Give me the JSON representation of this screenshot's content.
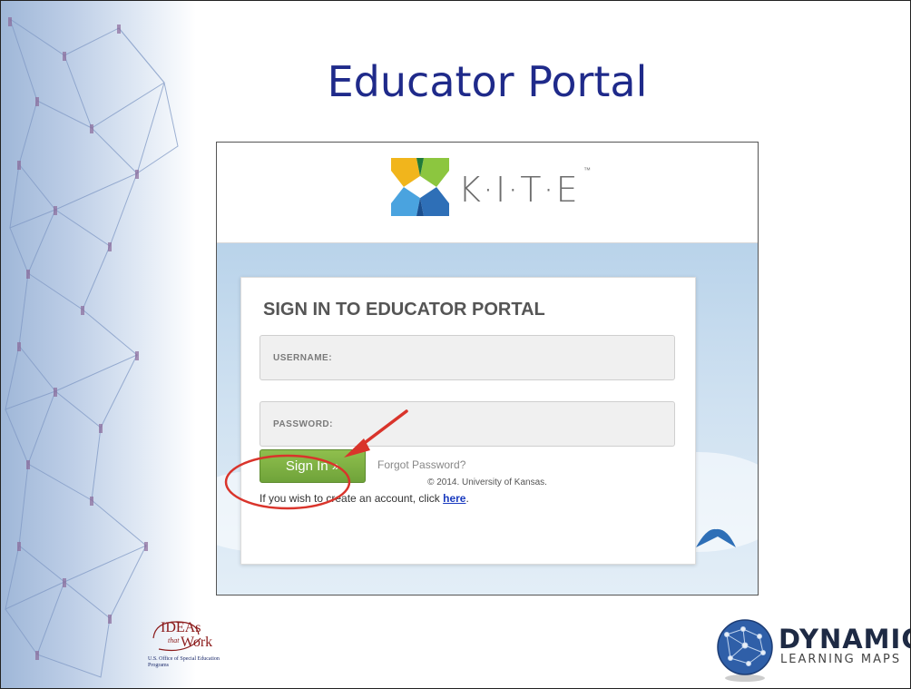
{
  "slide": {
    "title": "Educator Portal"
  },
  "kite": {
    "wordmark": "K·I·T·E",
    "trademark": "™"
  },
  "signin": {
    "heading": "SIGN IN TO EDUCATOR PORTAL",
    "username_placeholder": "USERNAME:",
    "password_placeholder": "PASSWORD:",
    "signin_button": "Sign In »",
    "forgot_link": "Forgot Password?",
    "create_text": "If you wish to create an account, click ",
    "create_link": "here",
    "create_end": "."
  },
  "footer": {
    "copyright": "© 2014. University of Kansas."
  },
  "logos": {
    "ideas_main": "IDEAs",
    "ideas_that": "that",
    "ideas_work": "Work",
    "ideas_sub": "U.S. Office of Special Education Programs",
    "dlm_word1": "DYNAMIC",
    "dlm_word2": "LEARNING MAPS"
  },
  "colors": {
    "title": "#1f2a8a",
    "signin_button": "#7bb142",
    "annotation": "#d9342b",
    "link": "#1a3bbf"
  },
  "icons": {
    "kite_logo": "kite-logo-icon",
    "annotation_arrow": "arrow-icon",
    "annotation_circle": "circle-highlight-icon",
    "dlm_globe": "globe-icon"
  }
}
